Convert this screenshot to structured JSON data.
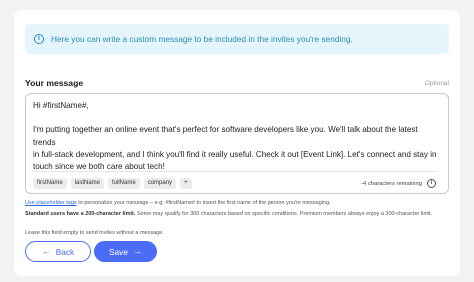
{
  "info": {
    "text": "Here you can write a custom message to be included in the invites you're sending."
  },
  "field": {
    "label": "Your message",
    "optional": "Optional",
    "value": "Hi #firstName#,\n\nI'm putting together an online event that's perfect for software developers like you. We'll talk about the latest trends\nin full-stack development, and I think you'll find it really useful. Check it out [Event Link]. Let's connect and stay in\ntouch since we both care about tech!",
    "tags": [
      "firstName",
      "lastName",
      "fullName",
      "company",
      "+"
    ],
    "remaining": "-4 characters remaining"
  },
  "help": {
    "line1_link": "Use placeholder tags",
    "line1_rest": " to personalize your message – e.g. #firstName# to insert the first name of the person you're messaging.",
    "line2_bold": "Standard users have a 200-character limit.",
    "line2_rest": " Some may qualify for 300 characters based on specific conditions. Premium members always enjoy a 300-character limit.",
    "line3": "Leave this field empty to send invites without a message."
  },
  "buttons": {
    "back_label": "Back",
    "back_icon": "arrow-left-icon",
    "save_label": "Save",
    "save_icon": "arrow-right-icon"
  },
  "colors": {
    "accent": "#4a6cf7",
    "info_bg": "#e4f5fb",
    "info_text": "#2b8db8",
    "page_bg": "#f3f3f1"
  }
}
